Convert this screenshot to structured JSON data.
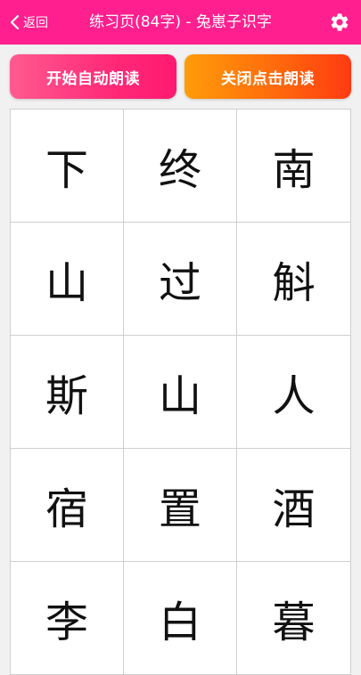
{
  "header": {
    "back_label": "返回",
    "title": "练习页(84字) - 兔崽子识字",
    "settings_icon": "gear-icon",
    "back_icon": "chevron-left-icon"
  },
  "buttons": {
    "auto_read": "开始自动朗读",
    "click_read_off": "关闭点击朗读"
  },
  "characters": [
    "下",
    "终",
    "南",
    "山",
    "过",
    "斛",
    "斯",
    "山",
    "人",
    "宿",
    "置",
    "酒",
    "李",
    "白",
    "暮"
  ],
  "colors": {
    "header_bg": "#ff1f8e",
    "left_button": "#ff2a78",
    "right_button": "#ff6a0c"
  }
}
